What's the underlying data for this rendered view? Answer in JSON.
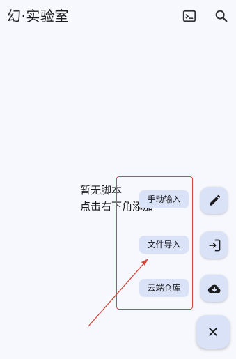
{
  "appbar": {
    "title": "幻·实验室",
    "terminal_icon": "terminal-icon",
    "search_icon": "search-icon"
  },
  "empty_state": {
    "line1": "暂无脚本",
    "line2": "点击右下角添加"
  },
  "fab_menu": {
    "items": [
      {
        "label": "手动输入",
        "icon": "pencil-icon"
      },
      {
        "label": "文件导入",
        "icon": "login-import-icon"
      },
      {
        "label": "云端仓库",
        "icon": "cloud-download-icon"
      }
    ],
    "close_icon": "close-icon"
  },
  "colors": {
    "background": "#f7f8fe",
    "fab_container": "#d9e2f6",
    "annotation": "#d2483c"
  }
}
